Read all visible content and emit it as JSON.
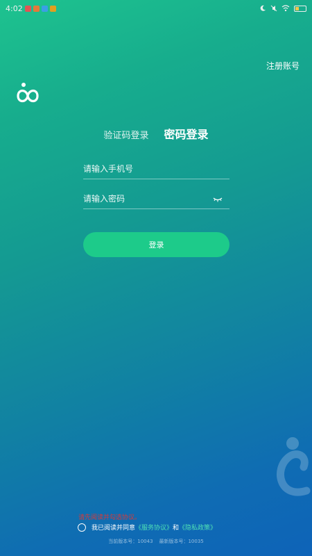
{
  "status_bar": {
    "time": "4:02",
    "icons": [
      "moon-icon",
      "mute-icon",
      "wifi-icon",
      "battery-icon"
    ],
    "notification_colors": [
      "#e05555",
      "#e27a3a",
      "#3aa0e6",
      "#e0a020"
    ]
  },
  "header": {
    "register_label": "注册账号"
  },
  "tabs": {
    "sms_login": "验证码登录",
    "password_login": "密码登录"
  },
  "form": {
    "phone_placeholder": "请输入手机号",
    "password_placeholder": "请输入密码",
    "login_label": "登录"
  },
  "agreement": {
    "warning": "请先阅读并勾选协议。",
    "prefix": "我已阅读并同意",
    "service_link": "《服务协议》",
    "and": "和",
    "privacy_link": "《隐私政策》"
  },
  "version": {
    "current_label": "当前版本号：",
    "current": "10043",
    "latest_label": "最新版本号：",
    "latest": "10035"
  },
  "colors": {
    "accent": "#1dcb8a",
    "link": "#4fe0b4",
    "warning": "#d53a3a"
  }
}
